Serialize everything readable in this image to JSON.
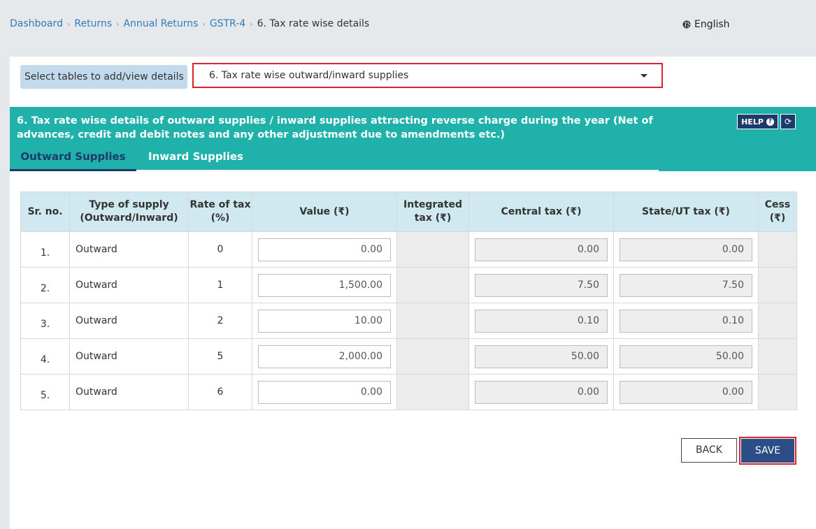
{
  "breadcrumb": {
    "items": [
      "Dashboard",
      "Returns",
      "Annual Returns",
      "GSTR-4"
    ],
    "current": "6. Tax rate wise details"
  },
  "language": "English",
  "selector": {
    "label": "Select tables to add/view details",
    "selected": "6. Tax rate wise outward/inward supplies"
  },
  "section": {
    "title": "6. Tax rate wise details of outward supplies / inward supplies attracting reverse charge during the year (Net of advances, credit and debit notes and any other adjustment due to amendments etc.)",
    "help_label": "HELP",
    "tabs": [
      "Outward Supplies",
      "Inward Supplies"
    ]
  },
  "table": {
    "headers": [
      "Sr. no.",
      "Type of supply (Outward/Inward)",
      "Rate of tax (%)",
      "Value (₹)",
      "Integrated tax (₹)",
      "Central tax (₹)",
      "State/UT tax (₹)",
      "Cess (₹)"
    ],
    "rows": [
      {
        "sr": "1.",
        "type": "Outward",
        "rate": "0",
        "value": "0.00",
        "central": "0.00",
        "state": "0.00"
      },
      {
        "sr": "2.",
        "type": "Outward",
        "rate": "1",
        "value": "1,500.00",
        "central": "7.50",
        "state": "7.50"
      },
      {
        "sr": "3.",
        "type": "Outward",
        "rate": "2",
        "value": "10.00",
        "central": "0.10",
        "state": "0.10"
      },
      {
        "sr": "4.",
        "type": "Outward",
        "rate": "5",
        "value": "2,000.00",
        "central": "50.00",
        "state": "50.00"
      },
      {
        "sr": "5.",
        "type": "Outward",
        "rate": "6",
        "value": "0.00",
        "central": "0.00",
        "state": "0.00"
      }
    ]
  },
  "buttons": {
    "back": "BACK",
    "save": "SAVE"
  },
  "colors": {
    "teal": "#20b2aa",
    "navy": "#1d3a6b",
    "highlight": "#d9232d",
    "link": "#337ab7"
  },
  "icons": {
    "language": "globe-icon",
    "help": "question-circle-icon",
    "refresh": "refresh-icon",
    "dropdown": "caret-down-icon"
  }
}
